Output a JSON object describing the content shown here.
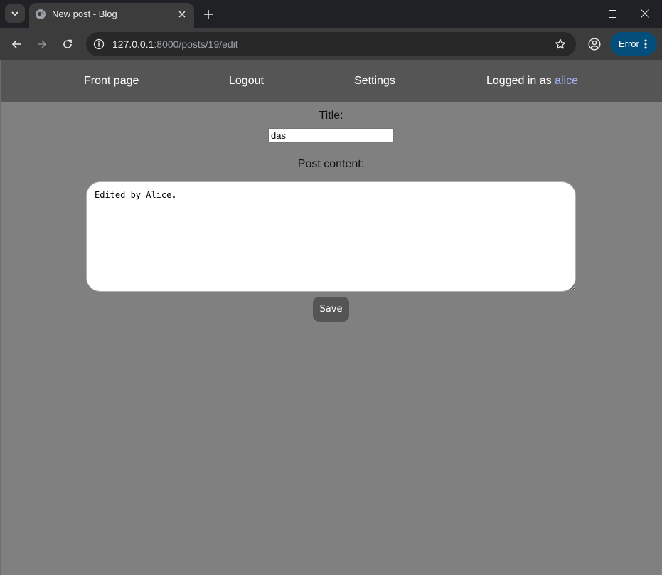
{
  "browser": {
    "tab": {
      "title": "New post - Blog"
    },
    "url": {
      "host": "127.0.0.1",
      "rest": ":8000/posts/19/edit"
    },
    "error_badge": "Error",
    "colors": {
      "tabstrip": "#202124",
      "toolbar": "#3c3c3c",
      "error": "#044e7c"
    }
  },
  "nav": {
    "front_page": "Front page",
    "logout": "Logout",
    "settings": "Settings",
    "logged_in_prefix": "Logged in as ",
    "username": "alice",
    "username_color": "#a3b4ff"
  },
  "form": {
    "title_label": "Title:",
    "title_value": "das",
    "content_label": "Post content:",
    "content_value": "Edited by Alice.",
    "save_label": "Save"
  }
}
